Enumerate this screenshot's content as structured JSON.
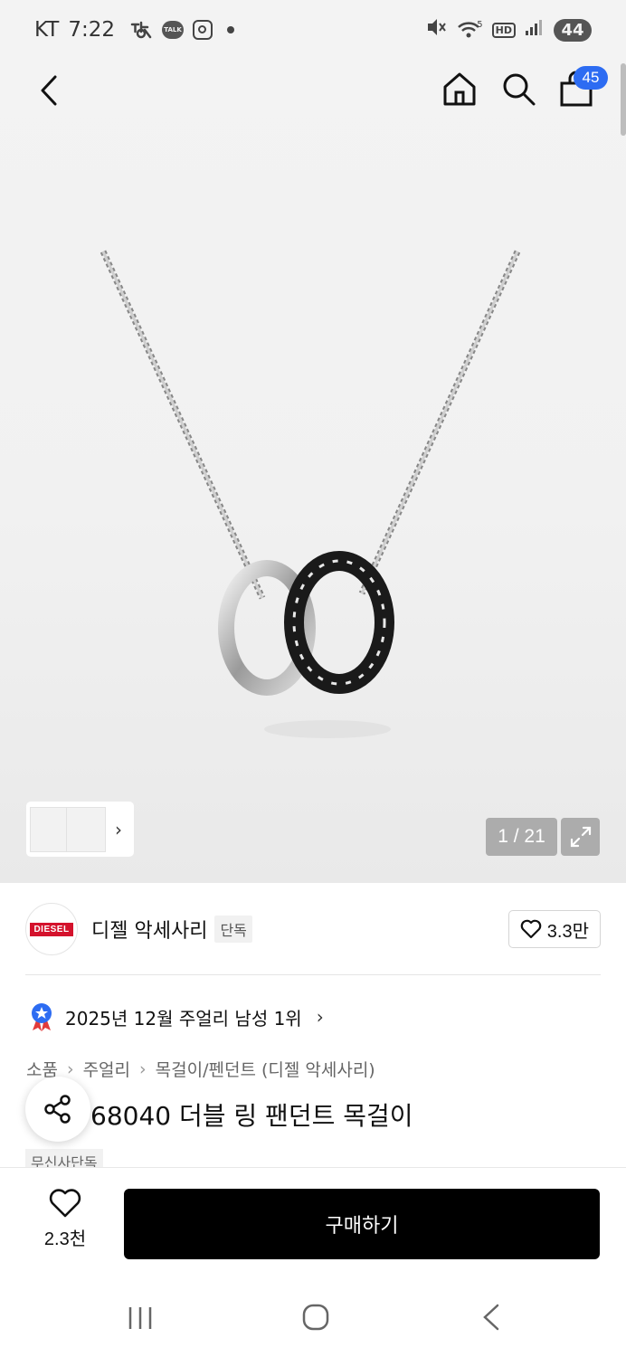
{
  "status_bar": {
    "carrier": "KT",
    "time": "7:22",
    "talk_label": "TALK",
    "hd_label": "HD",
    "network_label": "5",
    "battery": "44"
  },
  "header": {
    "cart_count": "45"
  },
  "gallery": {
    "page_indicator": "1 / 21"
  },
  "brand": {
    "logo_text": "DIESEL",
    "name": "디젤 악세사리",
    "tag": "단독",
    "like_count": "3.3만"
  },
  "ranking": {
    "text": "2025년 12월 주얼리 남성 1위"
  },
  "breadcrumb": [
    "소품",
    "주얼리",
    "목걸이/펜던트 (디젤 악세사리)"
  ],
  "product": {
    "title": "68040 더블 링 팬던트 목걸이",
    "exclusive_tag": "무신사단독"
  },
  "action_bar": {
    "wish_count": "2.3천",
    "buy_label": "구매하기"
  },
  "colors": {
    "accent_blue": "#2d6cf2",
    "brand_red": "#d4122c",
    "buy_button": "#000000"
  }
}
